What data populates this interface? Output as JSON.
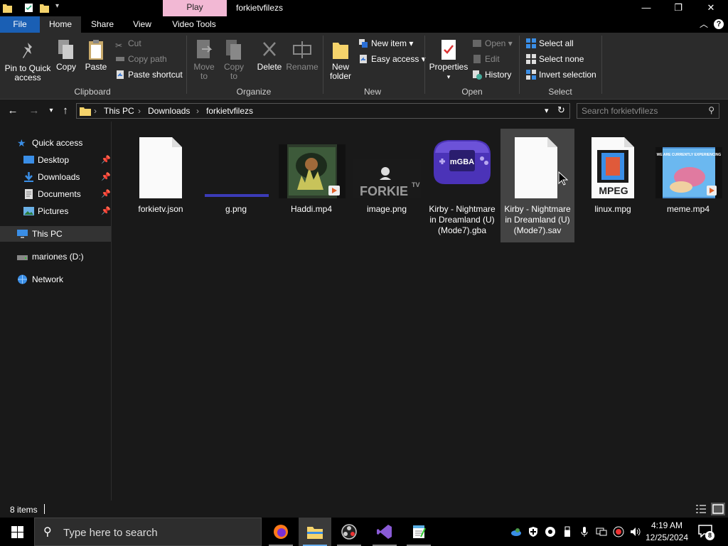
{
  "window": {
    "title": "forkietvfilezs",
    "context_tab": "Play",
    "controls": {
      "minimize": "—",
      "maximize": "❐",
      "close": "✕"
    }
  },
  "ribbon_tabs": [
    "File",
    "Home",
    "Share",
    "View",
    "Video Tools"
  ],
  "ribbon": {
    "clipboard": {
      "label": "Clipboard",
      "pin": "Pin to Quick access",
      "copy": "Copy",
      "paste": "Paste",
      "cut": "Cut",
      "copy_path": "Copy path",
      "paste_shortcut": "Paste shortcut"
    },
    "organize": {
      "label": "Organize",
      "move_to": "Move to",
      "copy_to": "Copy to",
      "delete": "Delete",
      "rename": "Rename"
    },
    "new": {
      "label": "New",
      "new_folder": "New folder",
      "new_item": "New item",
      "easy_access": "Easy access"
    },
    "open": {
      "label": "Open",
      "properties": "Properties",
      "open": "Open",
      "edit": "Edit",
      "history": "History"
    },
    "select": {
      "label": "Select",
      "select_all": "Select all",
      "select_none": "Select none",
      "invert": "Invert selection"
    }
  },
  "breadcrumb": [
    "This PC",
    "Downloads",
    "forkietvfilezs"
  ],
  "search": {
    "placeholder": "Search forkietvfilezs"
  },
  "nav": {
    "quick_access": "Quick access",
    "desktop": "Desktop",
    "downloads": "Downloads",
    "documents": "Documents",
    "pictures": "Pictures",
    "this_pc": "This PC",
    "drive": "mariones (D:)",
    "network": "Network"
  },
  "files": [
    {
      "name": "forkietv.json",
      "icon": "blank-file-icon"
    },
    {
      "name": "g.png",
      "icon": "image-thumbnail"
    },
    {
      "name": "Haddi.mp4",
      "icon": "video-thumbnail"
    },
    {
      "name": "image.png",
      "icon": "image-thumbnail",
      "thumb_text": "FORKIE",
      "thumb_sup": "TV"
    },
    {
      "name": "Kirby - Nightmare in Dreamland (U)(Mode7).gba",
      "icon": "mgba-icon",
      "thumb_text": "mGBA"
    },
    {
      "name": "Kirby - Nightmare in Dreamland (U)(Mode7).sav",
      "icon": "blank-file-icon"
    },
    {
      "name": "linux.mpg",
      "icon": "mpeg-file-icon",
      "thumb_text": "MPEG"
    },
    {
      "name": "meme.mp4",
      "icon": "video-thumbnail",
      "thumb_text": "WE ARE CURRENTLY EXPERIENCING"
    }
  ],
  "status": {
    "item_count": "8 items"
  },
  "taskbar": {
    "search_placeholder": "Type here to search",
    "time": "4:19 AM",
    "date": "12/25/2024",
    "notif_count": "8"
  },
  "colors": {
    "accent": "#1a5fb4",
    "context_tab": "#f2b8d4",
    "mgba_purple": "#5b3fc4"
  }
}
